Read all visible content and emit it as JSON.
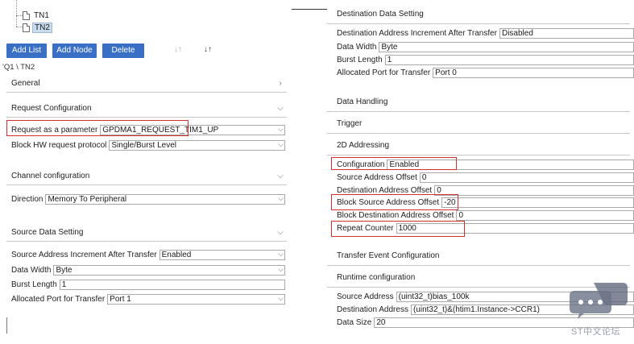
{
  "tree": {
    "node1": "TN1",
    "node2": "TN2"
  },
  "toolbar": {
    "add_list": "Add List",
    "add_node": "Add Node",
    "delete": "Delete",
    "icon1": "↓↑",
    "icon2": "↓↑"
  },
  "path": "'Q1 \\ TN2",
  "left": {
    "general": "General",
    "request_config": "Request Configuration",
    "request_param_label": "Request as a parameter",
    "request_param_value": "GPDMA1_REQUEST_TIM1_UP",
    "block_hw_label": "Block HW request protocol",
    "block_hw_value": "Single/Burst Level",
    "channel_config": "Channel configuration",
    "direction_label": "Direction",
    "direction_value": "Memory To Peripheral",
    "source_data_setting": "Source Data Setting",
    "src_incr_label": "Source Address Increment After Transfer",
    "src_incr_value": "Enabled",
    "data_width_label": "Data Width",
    "data_width_value": "Byte",
    "burst_length_label": "Burst Length",
    "burst_length_value": "1",
    "alloc_port_label": "Allocated Port for Transfer",
    "alloc_port_value": "Port 1"
  },
  "right": {
    "dest_data_setting": "Destination Data Setting",
    "dest_incr_label": "Destination Address Increment After Transfer",
    "dest_incr_value": "Disabled",
    "data_width_label": "Data Width",
    "data_width_value": "Byte",
    "burst_length_label": "Burst Length",
    "burst_length_value": "1",
    "alloc_port_label": "Allocated Port for Transfer",
    "alloc_port_value": "Port 0",
    "data_handling": "Data Handling",
    "trigger": "Trigger",
    "addressing_2d": "2D Addressing",
    "configuration_label": "Configuration",
    "configuration_value": "Enabled",
    "src_offset_label": "Source Address Offset",
    "src_offset_value": "0",
    "dst_offset_label": "Destination Address Offset",
    "dst_offset_value": "0",
    "block_src_offset_label": "Block Source Address Offset",
    "block_src_offset_value": "-20",
    "block_dst_offset_label": "Block Destination Address Offset",
    "block_dst_offset_value": "0",
    "repeat_counter_label": "Repeat Counter",
    "repeat_counter_value": "1000",
    "transfer_event_config": "Transfer Event Configuration",
    "runtime_config": "Runtime configuration",
    "source_address_label": "Source Address",
    "source_address_value": "(uint32_t)bias_100k",
    "destination_address_label": "Destination Address",
    "destination_address_value": "(uint32_t)&(htim1.Instance->CCR1)",
    "data_size_label": "Data Size",
    "data_size_value": "20"
  },
  "watermark": {
    "text": "ST中文论坛"
  },
  "colors": {
    "button_blue": "#3a6fc6",
    "highlight_red": "#d32f2f",
    "selected_bg": "#c9dcef"
  }
}
